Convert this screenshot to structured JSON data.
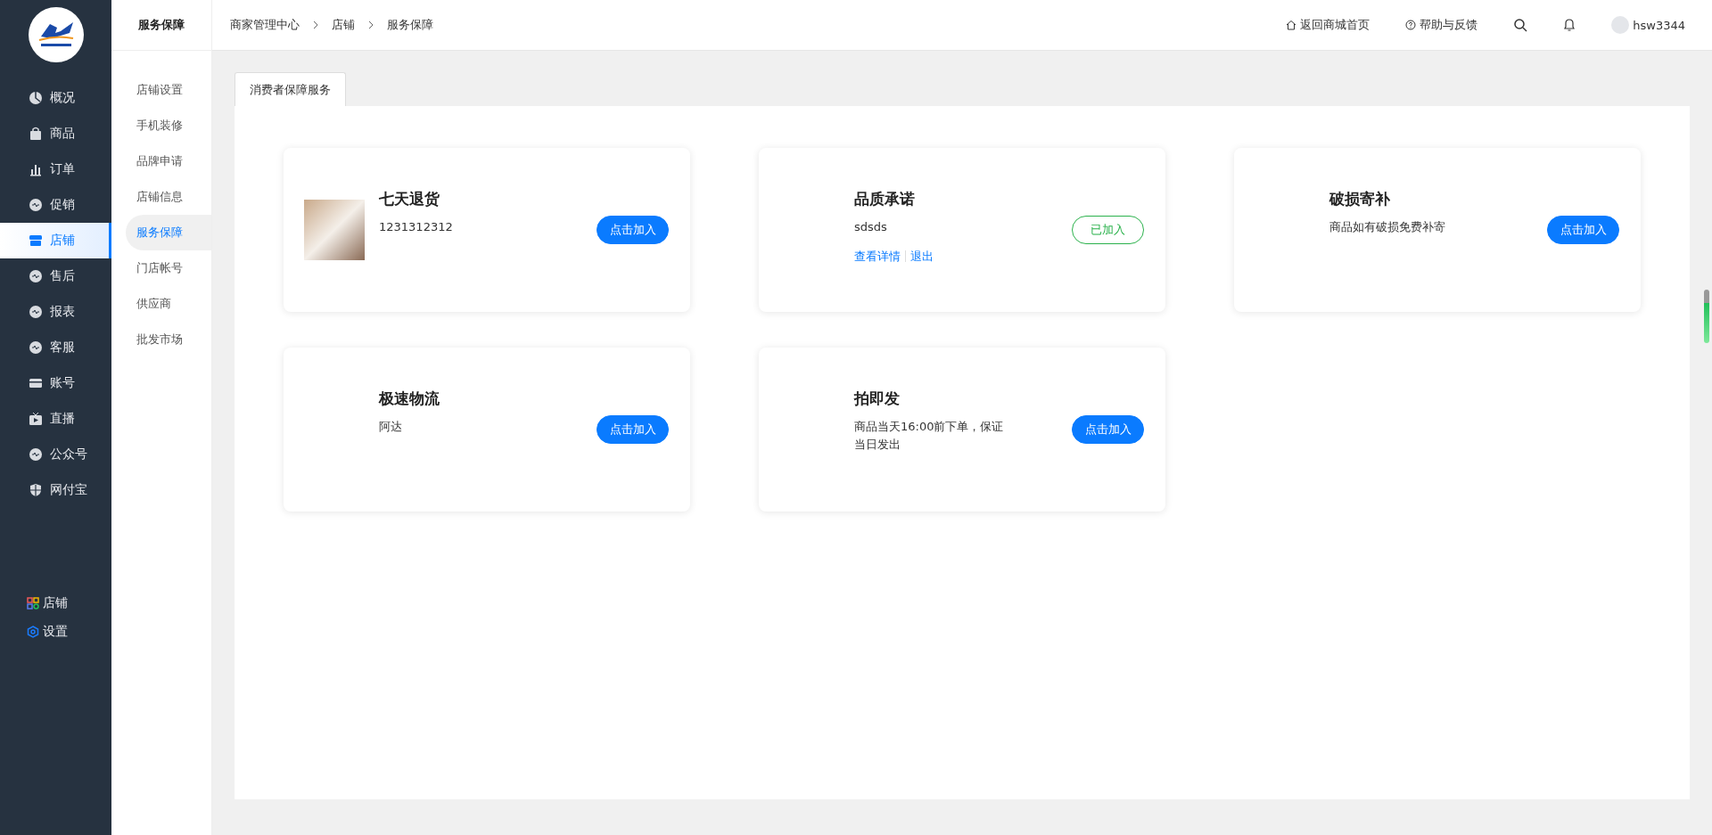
{
  "sidebar": {
    "items": [
      {
        "label": "概况",
        "selected": false
      },
      {
        "label": "商品",
        "selected": false
      },
      {
        "label": "订单",
        "selected": false
      },
      {
        "label": "促销",
        "selected": false
      },
      {
        "label": "店铺",
        "selected": true
      },
      {
        "label": "售后",
        "selected": false
      },
      {
        "label": "报表",
        "selected": false
      },
      {
        "label": "客服",
        "selected": false
      },
      {
        "label": "账号",
        "selected": false
      },
      {
        "label": "直播",
        "selected": false
      },
      {
        "label": "公众号",
        "selected": false
      },
      {
        "label": "网付宝",
        "selected": false
      }
    ],
    "bottom_items": [
      {
        "label": "店铺"
      },
      {
        "label": "设置"
      }
    ]
  },
  "subnav": {
    "title": "服务保障",
    "items": [
      {
        "label": "店铺设置",
        "selected": false
      },
      {
        "label": "手机装修",
        "selected": false
      },
      {
        "label": "品牌申请",
        "selected": false
      },
      {
        "label": "店铺信息",
        "selected": false
      },
      {
        "label": "服务保障",
        "selected": true
      },
      {
        "label": "门店帐号",
        "selected": false
      },
      {
        "label": "供应商",
        "selected": false
      },
      {
        "label": "批发市场",
        "selected": false
      }
    ]
  },
  "breadcrumb": [
    "商家管理中心",
    "店铺",
    "服务保障"
  ],
  "header": {
    "home_link": "返回商城首页",
    "help_link": "帮助与反馈",
    "username": "hsw3344"
  },
  "tabs": [
    {
      "label": "消费者保障服务"
    }
  ],
  "cards": [
    {
      "kind": "photo",
      "title": "七天退货",
      "description": "1231312312",
      "joined": false,
      "button": "点击加入"
    },
    {
      "kind": "plain",
      "title": "品质承诺",
      "description": "sdsds",
      "joined": true,
      "button": "已加入",
      "links": [
        "查看详情",
        "退出"
      ]
    },
    {
      "kind": "plain",
      "title": "破损寄补",
      "description": "商品如有破损免费补寄",
      "joined": false,
      "button": "点击加入"
    },
    {
      "kind": "plain",
      "title": "极速物流",
      "description": "阿达",
      "joined": false,
      "button": "点击加入"
    },
    {
      "kind": "plain",
      "title": "拍即发",
      "description": "商品当天16:00前下单，保证当日发出",
      "joined": false,
      "button": "点击加入"
    }
  ]
}
